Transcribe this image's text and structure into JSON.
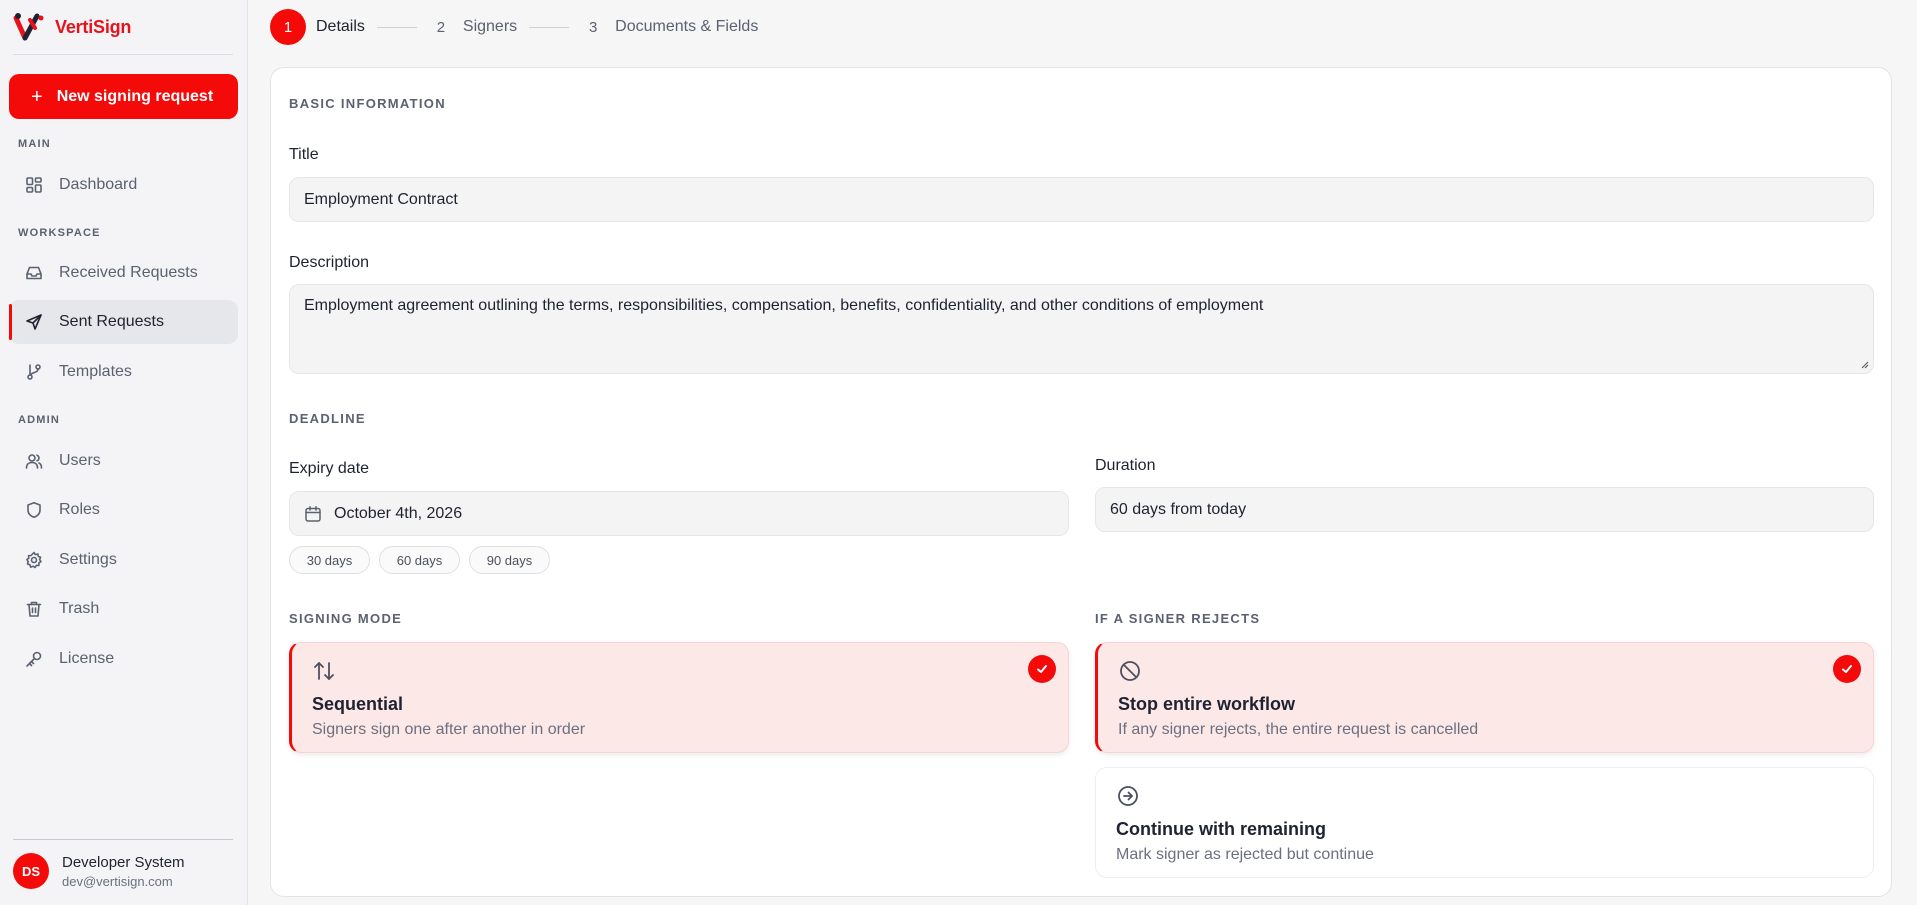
{
  "brand": {
    "name": "VertiSign"
  },
  "sidebar": {
    "new_request_label": "New signing request",
    "sections": {
      "main": "MAIN",
      "workspace": "WORKSPACE",
      "admin": "ADMIN"
    },
    "items": [
      {
        "label": "Dashboard",
        "icon": "dashboard-icon"
      },
      {
        "label": "Received Requests",
        "icon": "inbox-icon"
      },
      {
        "label": "Sent Requests",
        "icon": "send-icon",
        "active": true
      },
      {
        "label": "Templates",
        "icon": "branch-icon"
      },
      {
        "label": "Users",
        "icon": "users-icon"
      },
      {
        "label": "Roles",
        "icon": "shield-icon"
      },
      {
        "label": "Settings",
        "icon": "gear-icon"
      },
      {
        "label": "Trash",
        "icon": "trash-icon"
      },
      {
        "label": "License",
        "icon": "key-icon"
      }
    ],
    "user": {
      "initials": "DS",
      "name": "Developer System",
      "email": "dev@vertisign.com"
    }
  },
  "stepper": {
    "steps": [
      {
        "number": "1",
        "label": "Details",
        "active": true
      },
      {
        "number": "2",
        "label": "Signers"
      },
      {
        "number": "3",
        "label": "Documents & Fields"
      }
    ]
  },
  "form": {
    "basic_info_title": "BASIC INFORMATION",
    "title_label": "Title",
    "title_value": "Employment Contract",
    "description_label": "Description",
    "description_value": "Employment agreement outlining the terms, responsibilities, compensation, benefits, confidentiality, and other conditions of employment",
    "deadline_title": "DEADLINE",
    "expiry_label": "Expiry date",
    "expiry_value": "October 4th, 2026",
    "presets": [
      "30 days",
      "60 days",
      "90 days"
    ],
    "duration_label": "Duration",
    "duration_value": "60 days from today",
    "signing_mode_title": "SIGNING MODE",
    "signing_mode": {
      "title": "Sequential",
      "desc": "Signers sign one after another in order",
      "selected": true
    },
    "reject_title": "IF A SIGNER REJECTS",
    "reject_options": [
      {
        "title": "Stop entire workflow",
        "desc": "If any signer rejects, the entire request is cancelled",
        "selected": true,
        "icon": "ban-icon"
      },
      {
        "title": "Continue with remaining",
        "desc": "Mark signer as rejected but continue",
        "selected": false,
        "icon": "arrow-circle-icon"
      }
    ]
  },
  "colors": {
    "accent": "#f50a0a",
    "selected_bg": "#fde8e8"
  }
}
